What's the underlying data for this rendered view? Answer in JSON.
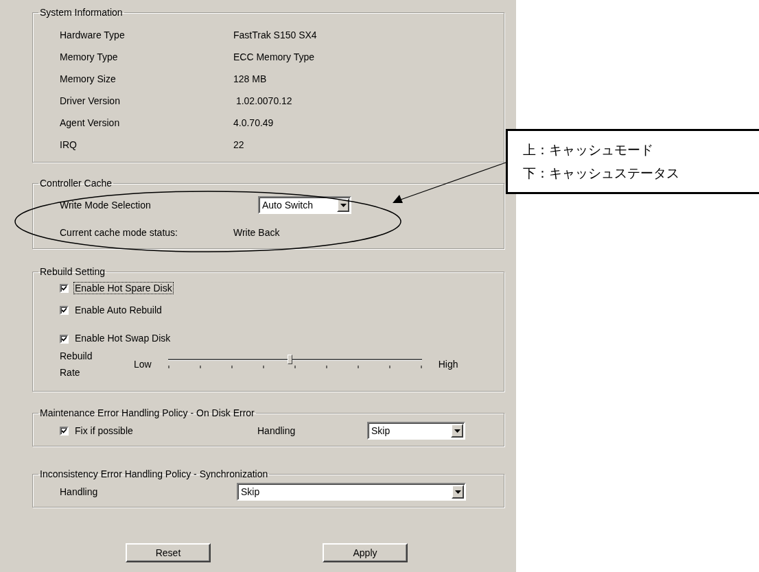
{
  "system_information": {
    "title": "System Information",
    "rows": [
      {
        "label": "Hardware Type",
        "value": "FastTrak S150 SX4"
      },
      {
        "label": "Memory Type",
        "value": "ECC Memory Type"
      },
      {
        "label": "Memory Size",
        "value": "128 MB"
      },
      {
        "label": "Driver Version",
        "value": " 1.02.0070.12"
      },
      {
        "label": "Agent Version",
        "value": "4.0.70.49"
      },
      {
        "label": "IRQ",
        "value": "22"
      }
    ]
  },
  "controller_cache": {
    "title": "Controller Cache",
    "write_mode": {
      "label": "Write Mode Selection",
      "value": "Auto Switch"
    },
    "status": {
      "label": "Current cache mode status:",
      "value": "Write Back"
    }
  },
  "rebuild_setting": {
    "title": "Rebuild Setting",
    "options": [
      {
        "label": "Enable Hot Spare Disk",
        "checked": true,
        "focused": true
      },
      {
        "label": "Enable Auto Rebuild",
        "checked": true,
        "focused": false
      },
      {
        "label": "Enable Hot Swap Disk",
        "checked": true,
        "focused": false
      }
    ],
    "rate": {
      "label": "Rebuild Rate",
      "low": "Low",
      "high": "High",
      "level": 0.48
    }
  },
  "maintenance": {
    "title": "Maintenance Error Handling Policy - On Disk Error",
    "fix": {
      "label": "Fix if possible",
      "checked": true
    },
    "handling": {
      "label": "Handling",
      "value": "Skip"
    }
  },
  "inconsistency": {
    "title": "Inconsistency Error Handling Policy - Synchronization",
    "handling": {
      "label": "Handling",
      "value": "Skip"
    }
  },
  "buttons": [
    "Reset",
    "Apply"
  ],
  "callout": {
    "lines": [
      "上：キャッシュモード",
      "下：キャッシュステータス"
    ]
  }
}
